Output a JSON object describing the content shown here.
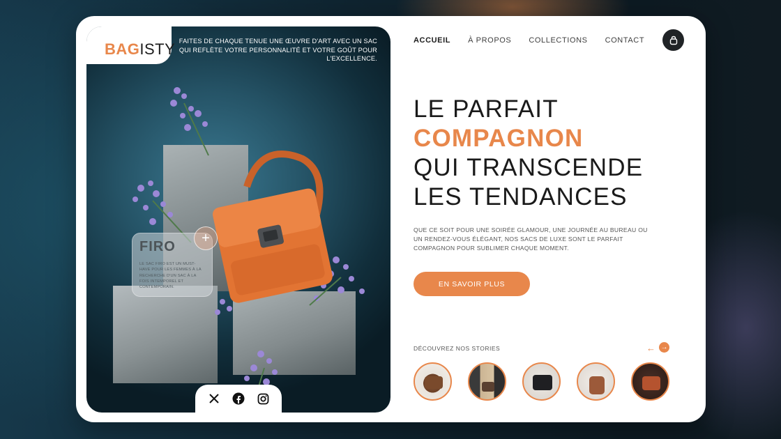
{
  "brand": {
    "logo_part1": "BAG",
    "logo_part2": "ISTY"
  },
  "tagline": "FAITES DE CHAQUE TENUE UNE ŒUVRE D'ART AVEC UN SAC QUI REFLÈTE VOTRE PERSONNALITÉ ET VOTRE GOÛT POUR L'EXCELLENCE.",
  "nav": {
    "items": [
      {
        "label": "ACCUEIL"
      },
      {
        "label": "À PROPOS"
      },
      {
        "label": "COLLECTIONS"
      },
      {
        "label": "CONTACT"
      }
    ],
    "active": "ACCUEIL"
  },
  "hero": {
    "line1": "LE PARFAIT",
    "line2": "COMPAGNON",
    "line3": "QUI TRANSCENDE",
    "line4": "LES TENDANCES",
    "description": "QUE CE SOIT POUR UNE SOIRÉE GLAMOUR, UNE JOURNÉE AU BUREAU OU UN RENDEZ-VOUS ÉLÉGANT, NOS SACS DE LUXE SONT LE PARFAIT COMPAGNON POUR SUBLIMER CHAQUE MOMENT.",
    "cta": "EN SAVOIR PLUS"
  },
  "product_card": {
    "name": "FIRO",
    "text": "LE SAC FIRO EST UN MUST-HAVE POUR LES FEMMES À LA RECHERCHE D'UN SAC À LA FOIS INTEMPOREL ET CONTEMPORAIN.",
    "plus": "+"
  },
  "stories": {
    "label": "DÉCOUVREZ NOS STORIES",
    "prev": "←",
    "next": "→",
    "items": [
      {
        "icon": "brown-handbag-story"
      },
      {
        "icon": "beige-coat-story"
      },
      {
        "icon": "black-bag-story"
      },
      {
        "icon": "tan-tote-story"
      },
      {
        "icon": "rust-bag-story"
      }
    ]
  },
  "social": [
    "x-icon",
    "facebook-icon",
    "instagram-icon"
  ],
  "colors": {
    "accent": "#e8874b",
    "dark": "#202326",
    "text": "#1a1a1a"
  }
}
